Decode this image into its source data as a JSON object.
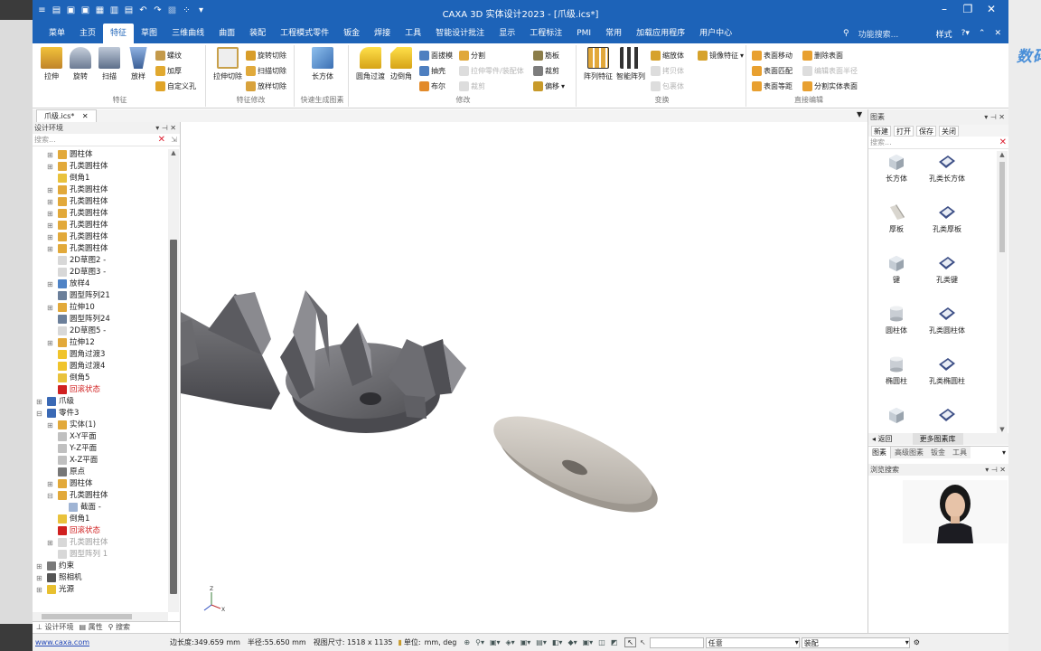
{
  "window": {
    "title": "CAXA 3D 实体设计2023 - [爪级.ics*]",
    "quick_access_icons": [
      "app-menu-icon",
      "new-file-icon",
      "open-file-icon",
      "close-file-icon",
      "save-icon",
      "save-all-icon",
      "print-icon",
      "undo-icon",
      "redo-icon",
      "disabled-tool-icon",
      "customize-icon"
    ],
    "controls": [
      "minimize",
      "restore",
      "close"
    ]
  },
  "menubar": {
    "tabs": [
      "菜单",
      "主页",
      "特征",
      "草图",
      "三维曲线",
      "曲面",
      "装配",
      "工程模式零件",
      "钣金",
      "焊接",
      "工具",
      "智能设计批注",
      "显示",
      "工程标注",
      "PMI",
      "常用",
      "加载应用程序",
      "用户中心"
    ],
    "active_tab": "特征",
    "search_placeholder": "功能搜索...",
    "style_label": "样式",
    "help": "?"
  },
  "ribbon": {
    "groups": [
      {
        "label": "特征",
        "big": [
          "拉伸",
          "旋转",
          "扫描",
          "放样"
        ],
        "small": [
          "螺纹",
          "加厚",
          "自定义孔"
        ]
      },
      {
        "label": "特征修改",
        "big": [
          "拉伸切除"
        ],
        "small": [
          "旋转切除",
          "扫描切除",
          "放样切除"
        ]
      },
      {
        "label": "快速生成图素",
        "big": [
          "长方体"
        ],
        "small": []
      },
      {
        "label": "修改",
        "big": [
          "圆角过渡",
          "边倒角"
        ],
        "small": [
          "面拔模",
          "抽壳",
          "布尔",
          "分割",
          "拉伸零件/装配体",
          "裁剪",
          "筋板",
          "裁剪",
          "偏移"
        ]
      },
      {
        "label": "变换",
        "big": [
          "阵列特征",
          "智能阵列"
        ],
        "small": [
          "缩放体",
          "镜像特征",
          "拷贝体",
          "包裹体"
        ]
      },
      {
        "label": "直接编辑",
        "big": [],
        "small": [
          "表面移动",
          "删除表面",
          "表面匹配",
          "编辑表面半径",
          "表面等距",
          "分割实体表面"
        ]
      }
    ]
  },
  "document": {
    "tab": "爪级.ics*"
  },
  "left_panel": {
    "title": "设计环境",
    "search_placeholder": "搜索...",
    "tree": [
      {
        "label": "圆柱体",
        "indent": 2,
        "exp": "+",
        "icon": "solid-icon",
        "state": "normal"
      },
      {
        "label": "孔类圆柱体",
        "indent": 2,
        "exp": "+",
        "icon": "solid-icon",
        "state": "normal"
      },
      {
        "label": "倒角1",
        "indent": 2,
        "exp": "",
        "icon": "chamfer-icon",
        "state": "normal"
      },
      {
        "label": "孔类圆柱体",
        "indent": 2,
        "exp": "+",
        "icon": "solid-icon",
        "state": "normal"
      },
      {
        "label": "孔类圆柱体",
        "indent": 2,
        "exp": "+",
        "icon": "solid-icon",
        "state": "normal"
      },
      {
        "label": "孔类圆柱体",
        "indent": 2,
        "exp": "+",
        "icon": "solid-icon",
        "state": "normal"
      },
      {
        "label": "孔类圆柱体",
        "indent": 2,
        "exp": "+",
        "icon": "solid-icon",
        "state": "normal"
      },
      {
        "label": "孔类圆柱体",
        "indent": 2,
        "exp": "+",
        "icon": "solid-icon",
        "state": "normal"
      },
      {
        "label": "孔类圆柱体",
        "indent": 2,
        "exp": "+",
        "icon": "solid-icon",
        "state": "normal"
      },
      {
        "label": "2D草图2 -",
        "indent": 2,
        "exp": "",
        "icon": "sketch-icon",
        "state": "normal"
      },
      {
        "label": "2D草图3 -",
        "indent": 2,
        "exp": "",
        "icon": "sketch-icon",
        "state": "normal"
      },
      {
        "label": "放样4",
        "indent": 2,
        "exp": "+",
        "icon": "loft-icon",
        "state": "normal"
      },
      {
        "label": "圆型阵列21",
        "indent": 2,
        "exp": "",
        "icon": "pattern-icon",
        "state": "normal"
      },
      {
        "label": "拉伸10",
        "indent": 2,
        "exp": "+",
        "icon": "solid-icon",
        "state": "normal"
      },
      {
        "label": "圆型阵列24",
        "indent": 2,
        "exp": "",
        "icon": "pattern-icon",
        "state": "normal"
      },
      {
        "label": "2D草图5 -",
        "indent": 2,
        "exp": "",
        "icon": "sketch-icon",
        "state": "normal"
      },
      {
        "label": "拉伸12",
        "indent": 2,
        "exp": "+",
        "icon": "solid-icon",
        "state": "normal"
      },
      {
        "label": "圆角过渡3",
        "indent": 2,
        "exp": "",
        "icon": "fillet-icon",
        "state": "normal"
      },
      {
        "label": "圆角过渡4",
        "indent": 2,
        "exp": "",
        "icon": "fillet-icon",
        "state": "normal"
      },
      {
        "label": "倒角5",
        "indent": 2,
        "exp": "",
        "icon": "chamfer-icon",
        "state": "normal"
      },
      {
        "label": "回滚状态",
        "indent": 2,
        "exp": "",
        "icon": "rollback-icon",
        "state": "red"
      },
      {
        "label": "爪级",
        "indent": 1,
        "exp": "+",
        "icon": "part-icon",
        "state": "normal"
      },
      {
        "label": "零件3",
        "indent": 1,
        "exp": "-",
        "icon": "part-icon",
        "state": "normal"
      },
      {
        "label": "实体(1)",
        "indent": 2,
        "exp": "+",
        "icon": "body-icon",
        "state": "normal"
      },
      {
        "label": "X-Y平面",
        "indent": 2,
        "exp": "",
        "icon": "plane-icon",
        "state": "normal"
      },
      {
        "label": "Y-Z平面",
        "indent": 2,
        "exp": "",
        "icon": "plane-icon",
        "state": "normal"
      },
      {
        "label": "X-Z平面",
        "indent": 2,
        "exp": "",
        "icon": "plane-icon",
        "state": "normal"
      },
      {
        "label": "原点",
        "indent": 2,
        "exp": "",
        "icon": "origin-icon",
        "state": "normal"
      },
      {
        "label": "圆柱体",
        "indent": 2,
        "exp": "+",
        "icon": "solid-icon",
        "state": "normal"
      },
      {
        "label": "孔类圆柱体",
        "indent": 2,
        "exp": "-",
        "icon": "solid-icon",
        "state": "normal"
      },
      {
        "label": "截面 -",
        "indent": 3,
        "exp": "",
        "icon": "section-icon",
        "state": "normal"
      },
      {
        "label": "倒角1",
        "indent": 2,
        "exp": "",
        "icon": "chamfer-icon",
        "state": "normal"
      },
      {
        "label": "回滚状态",
        "indent": 2,
        "exp": "",
        "icon": "rollback-icon",
        "state": "red"
      },
      {
        "label": "孔类圆柱体",
        "indent": 2,
        "exp": "+",
        "icon": "solid-icon",
        "state": "gray"
      },
      {
        "label": "圆型阵列 1",
        "indent": 2,
        "exp": "",
        "icon": "pattern-icon",
        "state": "gray"
      },
      {
        "label": "约束",
        "indent": 1,
        "exp": "+",
        "icon": "constraint-icon",
        "state": "normal"
      },
      {
        "label": "照相机",
        "indent": 1,
        "exp": "+",
        "icon": "camera-icon",
        "state": "normal"
      },
      {
        "label": "光源",
        "indent": 1,
        "exp": "+",
        "icon": "light-icon",
        "state": "normal"
      }
    ],
    "bottom_tabs": [
      "设计环境",
      "属性",
      "搜索"
    ]
  },
  "right_panel": {
    "title": "图素",
    "buttons": [
      "新建",
      "打开",
      "保存",
      "关闭"
    ],
    "search_placeholder": "搜索...",
    "parts": [
      {
        "label": "长方体",
        "shape": "cube"
      },
      {
        "label": "孔类长方体",
        "shape": "hole"
      },
      {
        "label": "厚板",
        "shape": "plate"
      },
      {
        "label": "孔类厚板",
        "shape": "hole"
      },
      {
        "label": "键",
        "shape": "cube"
      },
      {
        "label": "孔类键",
        "shape": "hole"
      },
      {
        "label": "圆柱体",
        "shape": "cyl"
      },
      {
        "label": "孔类圆柱体",
        "shape": "hole"
      },
      {
        "label": "椭圆柱",
        "shape": "cyl"
      },
      {
        "label": "孔类椭圆柱",
        "shape": "hole"
      },
      {
        "label": "",
        "shape": "cube"
      },
      {
        "label": "",
        "shape": "hole"
      }
    ],
    "nav": [
      "返回",
      "更多图素库"
    ],
    "tabs": [
      "图素",
      "高级图素",
      "钣金",
      "工具"
    ],
    "browser_title": "浏览搜索"
  },
  "statusbar": {
    "url": "www.caxa.com",
    "edge_length": "边长度:349.659 mm",
    "radius": "半径:55.650 mm",
    "view_size": "视图尺寸: 1518 x 1135",
    "units_label": "单位:",
    "units_value": "mm, deg",
    "filter_value": "任意",
    "filter2_value": "装配"
  },
  "colors": {
    "title_blue": "#1d63b8",
    "metal": "#6e6e72",
    "plate": "#c6c1ba",
    "red": "#d02020"
  }
}
